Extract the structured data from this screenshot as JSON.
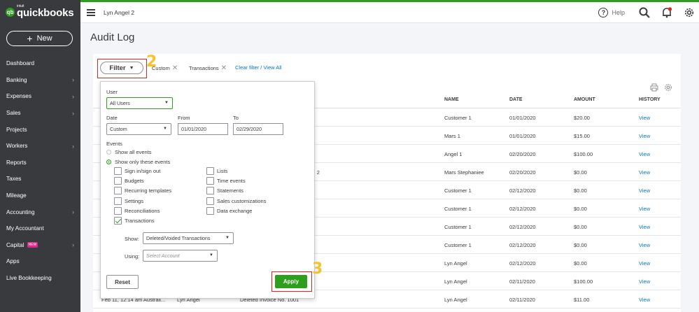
{
  "app": {
    "logo_sub": "intuit",
    "logo_text": "quickbooks",
    "company": "Lyn Angel 2",
    "help": "Help"
  },
  "sidebar": {
    "new_label": "New",
    "items": [
      {
        "label": "Dashboard",
        "chevron": false
      },
      {
        "label": "Banking",
        "chevron": true
      },
      {
        "label": "Expenses",
        "chevron": true
      },
      {
        "label": "Sales",
        "chevron": true
      },
      {
        "label": "Projects",
        "chevron": false
      },
      {
        "label": "Workers",
        "chevron": true
      },
      {
        "label": "Reports",
        "chevron": false
      },
      {
        "label": "Taxes",
        "chevron": false
      },
      {
        "label": "Mileage",
        "chevron": false
      },
      {
        "label": "Accounting",
        "chevron": true
      },
      {
        "label": "My Accountant",
        "chevron": false
      },
      {
        "label": "Capital",
        "chevron": true,
        "badge": "NEW"
      },
      {
        "label": "Apps",
        "chevron": false
      },
      {
        "label": "Live Bookkeeping",
        "chevron": false
      }
    ]
  },
  "page": {
    "title": "Audit Log",
    "filter_label": "Filter",
    "chips": [
      "Custom",
      "Transactions"
    ],
    "clear_link": "Clear filter / View All",
    "annotations": [
      "2",
      "3"
    ]
  },
  "table": {
    "headers": {
      "name": "NAME",
      "date": "DATE",
      "amount": "AMOUNT",
      "history": "HISTORY"
    },
    "rows": [
      {
        "date_changed": "",
        "user": "",
        "event": "",
        "name": "Customer 1",
        "date": "01/01/2020",
        "amount": "$20.00",
        "history": "View"
      },
      {
        "date_changed": "",
        "user": "",
        "event": "",
        "name": "Mars 1",
        "date": "01/01/2020",
        "amount": "$15.00",
        "history": "View"
      },
      {
        "date_changed": "",
        "user": "",
        "event": "",
        "name": "Angel 1",
        "date": "02/20/2020",
        "amount": "$100.00",
        "history": "View"
      },
      {
        "date_changed": "",
        "user": "",
        "event": "No. 2",
        "name": "Mars Stephaniee",
        "date": "02/20/2020",
        "amount": "$0.00",
        "history": "View"
      },
      {
        "date_changed": "",
        "user": "",
        "event": "",
        "name": "Customer 1",
        "date": "02/12/2020",
        "amount": "$0.00",
        "history": "View"
      },
      {
        "date_changed": "",
        "user": "",
        "event": "",
        "name": "Customer 1",
        "date": "02/12/2020",
        "amount": "$0.00",
        "history": "View"
      },
      {
        "date_changed": "",
        "user": "",
        "event": "",
        "name": "Customer 1",
        "date": "02/12/2020",
        "amount": "$0.00",
        "history": "View"
      },
      {
        "date_changed": "",
        "user": "",
        "event": "",
        "name": "Customer 1",
        "date": "02/12/2020",
        "amount": "$0.00",
        "history": "View"
      },
      {
        "date_changed": "",
        "user": "",
        "event": "",
        "name": "Lyn Angel",
        "date": "02/12/2020",
        "amount": "$0.00",
        "history": "View"
      },
      {
        "date_changed": "",
        "user": "",
        "event": "",
        "name": "Lyn Angel",
        "date": "02/11/2020",
        "amount": "$100.00",
        "history": "View"
      },
      {
        "date_changed": "Feb 11, 12:14 am Australi...",
        "user": "Lyn Angel",
        "event": "Deleted Invoice No. 1001",
        "name": "Lyn Angel",
        "date": "02/11/2020",
        "amount": "$11.00",
        "history": "View"
      }
    ]
  },
  "filter_panel": {
    "user_label": "User",
    "user_value": "All Users",
    "date_label": "Date",
    "date_value": "Custom",
    "from_label": "From",
    "from_value": "01/01/2020",
    "to_label": "To",
    "to_value": "02/29/2020",
    "events_label": "Events",
    "radio_all": "Show all events",
    "radio_only": "Show only these events",
    "checkboxes_left": [
      "Sign in/sign out",
      "Budgets",
      "Recurring templates",
      "Settings",
      "Reconciliations",
      "Transactions"
    ],
    "checkboxes_right": [
      "Lists",
      "Time events",
      "Statements",
      "Sales customizations",
      "Data exchange"
    ],
    "show_label": "Show:",
    "show_value": "Deleted/Voided Transactions",
    "using_label": "Using:",
    "using_placeholder": "Select Account",
    "reset_label": "Reset",
    "apply_label": "Apply"
  },
  "colors": {
    "brand_green": "#2ca01c",
    "sidebar_bg": "#393a3d",
    "link_blue": "#0077c5",
    "annotation_red": "#d52b1e",
    "annotation_yellow": "#f4c430"
  }
}
